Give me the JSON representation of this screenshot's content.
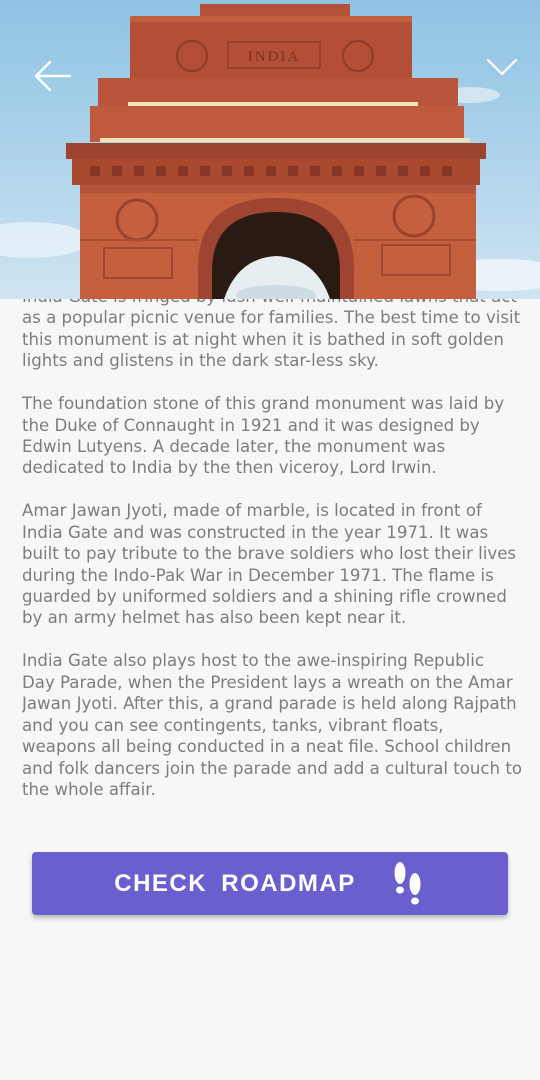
{
  "header": {
    "back_icon": "arrow-left-icon",
    "collapse_icon": "chevron-down-icon",
    "image_inscription": "INDIA"
  },
  "content": {
    "paragraphs": [
      "India Gate is fringed by lush well-maintained lawns that act as a popular picnic venue for families. The best time to visit this monument is at night when it is bathed in soft golden lights and glistens in the dark star-less sky.",
      "The foundation stone of this grand monument was laid by the Duke of Connaught in 1921 and it was designed by Edwin Lutyens. A decade later, the monument was dedicated to India by the then viceroy, Lord Irwin.",
      "Amar Jawan Jyoti, made of marble, is located in front of India Gate and was constructed in the year 1971. It was built to pay tribute to the brave soldiers who lost their lives during the Indo-Pak War in December 1971. The flame is guarded by uniformed soldiers and a shining rifle crowned by an army helmet has also been kept near it.",
      "India Gate also plays host to the awe-inspiring Republic Day Parade, when the President lays a wreath on the Amar Jawan Jyoti. After this, a grand parade is held along Rajpath and you can see contingents, tanks, vibrant floats, weapons all being conducted in a neat file. School children and folk dancers join the parade and add a cultural touch to the whole affair."
    ]
  },
  "roadmap_button": {
    "label": "CHECK  ROADMAP",
    "icon": "footsteps-icon",
    "color": "#6a5fce"
  }
}
